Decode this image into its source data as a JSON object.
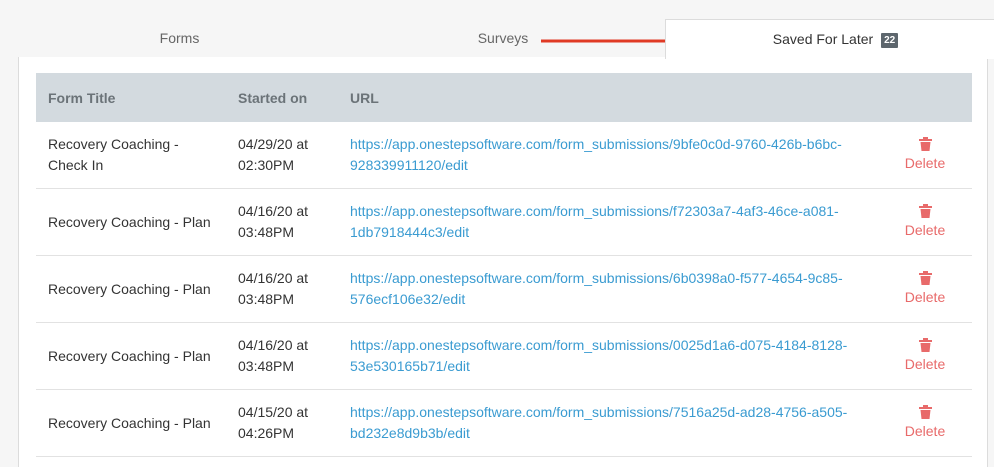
{
  "tabs": {
    "forms": "Forms",
    "surveys": "Surveys",
    "saved": "Saved For Later",
    "saved_count": "22"
  },
  "table": {
    "headers": [
      "Form Title",
      "Started on",
      "URL"
    ],
    "rows": [
      {
        "title": "Recovery Coaching - Check In",
        "started": "04/29/20 at 02:30PM",
        "url": "https://app.onestepsoftware.com/form_submissions/9bfe0c0d-9760-426b-b6bc-928339911120/edit",
        "action": "Delete"
      },
      {
        "title": "Recovery Coaching - Plan",
        "started": "04/16/20 at 03:48PM",
        "url": "https://app.onestepsoftware.com/form_submissions/f72303a7-4af3-46ce-a081-1db7918444c3/edit",
        "action": "Delete"
      },
      {
        "title": "Recovery Coaching - Plan",
        "started": "04/16/20 at 03:48PM",
        "url": "https://app.onestepsoftware.com/form_submissions/6b0398a0-f577-4654-9c85-576ecf106e32/edit",
        "action": "Delete"
      },
      {
        "title": "Recovery Coaching - Plan",
        "started": "04/16/20 at 03:48PM",
        "url": "https://app.onestepsoftware.com/form_submissions/0025d1a6-d075-4184-8128-53e530165b71/edit",
        "action": "Delete"
      },
      {
        "title": "Recovery Coaching - Plan",
        "started": "04/15/20 at 04:26PM",
        "url": "https://app.onestepsoftware.com/form_submissions/7516a25d-ad28-4756-a505-bd232e8d9b3b/edit",
        "action": "Delete"
      }
    ]
  },
  "colors": {
    "accent_link": "#3a9bd1",
    "delete_red": "#e86a6a",
    "arrow_red": "#e03a25",
    "header_bg": "#d3dadf"
  },
  "icons": {
    "delete": "trash-icon",
    "annotation": "arrow-annotation"
  }
}
